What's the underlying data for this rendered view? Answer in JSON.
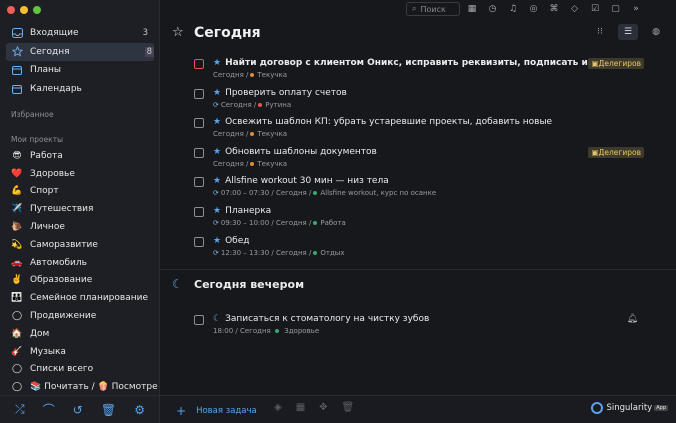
{
  "sidebar": {
    "nav": [
      {
        "label": "Входящие",
        "count": "3",
        "icon": "inbox-icon"
      },
      {
        "label": "Сегодня",
        "count": "8",
        "icon": "star-icon"
      },
      {
        "label": "Планы",
        "count": "",
        "icon": "calendar-icon"
      },
      {
        "label": "Календарь",
        "count": "",
        "icon": "calendar-icon"
      }
    ],
    "favorites_label": "Избранное",
    "projects_label": "Мои проекты",
    "projects": [
      {
        "emoji": "😎",
        "label": "Работа",
        "color": "#3aa76d"
      },
      {
        "emoji": "❤️",
        "label": "Здоровье",
        "color": "#e2574c"
      },
      {
        "emoji": "💪",
        "label": "Спорт",
        "color": "#3aa76d"
      },
      {
        "emoji": "✈️",
        "label": "Путешествия",
        "color": "#e2574c"
      },
      {
        "emoji": "🐌",
        "label": "Личное",
        "color": "#e28a3c"
      },
      {
        "emoji": "💫",
        "label": "Саморазвитие",
        "color": "#8d6ce0"
      },
      {
        "emoji": "🚗",
        "label": "Автомобиль",
        "color": "#e2574c"
      },
      {
        "emoji": "✌️",
        "label": "Образование",
        "color": "#3aa76d"
      },
      {
        "emoji": "👪",
        "label": "Семейное планирование",
        "color": "#e28a3c"
      },
      {
        "emoji": "◯",
        "label": "Продвижение",
        "color": "#e6c56b"
      },
      {
        "emoji": "🏠",
        "label": "Дом",
        "color": "#e6c56b"
      },
      {
        "emoji": "🎸",
        "label": "Музыка",
        "color": "#8d6ce0"
      },
      {
        "emoji": "◯",
        "label": "Списки всего",
        "color": "#e6c56b"
      },
      {
        "emoji": "◯",
        "label": "📚 Почитать / 🍿 Посмотре",
        "color": "#e6c56b"
      }
    ],
    "bottom_icons": [
      "shuffle-icon",
      "rainbow-icon",
      "history-icon",
      "trash-icon",
      "settings-icon"
    ]
  },
  "topbar": {
    "search_placeholder": "Поиск",
    "icons": [
      "calendar-icon",
      "timer-icon",
      "bell-icon",
      "chart-icon",
      "shortcut-icon",
      "tag-icon",
      "checklist-icon",
      "box-icon",
      "sidebar-icon"
    ]
  },
  "main": {
    "title": "Сегодня",
    "tasks": [
      {
        "title": "Найти договор с клиентом Оникс, исправить реквизиты, подписать и отправить",
        "bold": true,
        "sub": "Сегодня",
        "project": "Текучка",
        "dot": "#e28a3c",
        "tag": "Делегиров",
        "redbox": true,
        "repeat": false,
        "time": ""
      },
      {
        "title": "Проверить оплату счетов",
        "bold": false,
        "sub": "Сегодня",
        "project": "Рутина",
        "dot": "#e2574c",
        "tag": "",
        "redbox": false,
        "repeat": true,
        "time": ""
      },
      {
        "title": "Освежить шаблон КП: убрать устаревшие проекты, добавить новые",
        "bold": false,
        "sub": "Сегодня",
        "project": "Текучка",
        "dot": "#e28a3c",
        "tag": "",
        "redbox": false,
        "repeat": false,
        "time": ""
      },
      {
        "title": "Обновить шаблоны документов",
        "bold": false,
        "sub": "Сегодня",
        "project": "Текучка",
        "dot": "#e28a3c",
        "tag": "Делегиров",
        "redbox": false,
        "repeat": false,
        "time": ""
      },
      {
        "title": "Allsfine workout 30 мин — низ тела",
        "bold": false,
        "sub": "07:00 – 07:30 / Сегодня",
        "project": "Allsfine workout, курс по осанке",
        "dot": "#3aa76d",
        "tag": "",
        "redbox": false,
        "repeat": true,
        "time": ""
      },
      {
        "title": "Планерка",
        "bold": false,
        "sub": "09:30 – 10:00 / Сегодня",
        "project": "Работа",
        "dot": "#3aa76d",
        "tag": "",
        "redbox": false,
        "repeat": true,
        "time": ""
      },
      {
        "title": "Обед",
        "bold": false,
        "sub": "12:30 – 13:30 / Сегодня",
        "project": "Отдых",
        "dot": "#3aa76d",
        "tag": "",
        "redbox": false,
        "repeat": true,
        "time": ""
      }
    ],
    "evening_title": "Сегодня вечером",
    "evening_task": {
      "title": "Записаться к стоматологу на чистку зубов",
      "sub": "18:00 / Сегодня",
      "project": "Здоровье",
      "dot": "#3aa76d"
    }
  },
  "bottombar": {
    "new_task_label": "Новая задача",
    "brand": "Singularity",
    "brand_badge": "App"
  },
  "colors": {
    "accent": "#5aa3e8",
    "tag_text": "#e6c56b"
  }
}
